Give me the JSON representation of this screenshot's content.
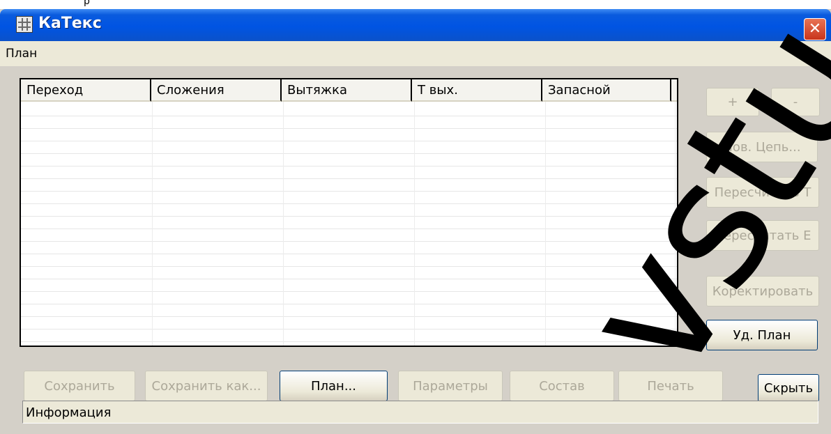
{
  "window": {
    "title": "КаТекс",
    "close_glyph": "✕",
    "icon": "calculator-grid-icon",
    "top_fragment": "p"
  },
  "menu": {
    "items": [
      "План"
    ]
  },
  "table": {
    "columns": [
      "Переход",
      "Сложения",
      "Вытяжка",
      "Т вых.",
      "Запасной"
    ],
    "rows": []
  },
  "side_buttons": {
    "plus": "+",
    "minus": "-",
    "new_chain": "Нов. Цепь...",
    "recalc_t": "Пересчитать Т",
    "recalc_e": "Пересчитать Е",
    "correct": "Коректировать",
    "delete_plan": "Уд. План"
  },
  "bottom_buttons": {
    "save": "Сохранить",
    "save_as": "Сохранить как...",
    "plan": "План...",
    "params": "Параметры",
    "composition": "Состав",
    "print": "Печать",
    "hide": "Скрыть"
  },
  "status": {
    "info": "Информация"
  },
  "watermark": {
    "text": "vstu.by"
  },
  "colors": {
    "titlebar": "#0054e3",
    "window_bg": "#d4d0c8",
    "close_button": "#e2573b",
    "disabled_text": "#aca899"
  }
}
